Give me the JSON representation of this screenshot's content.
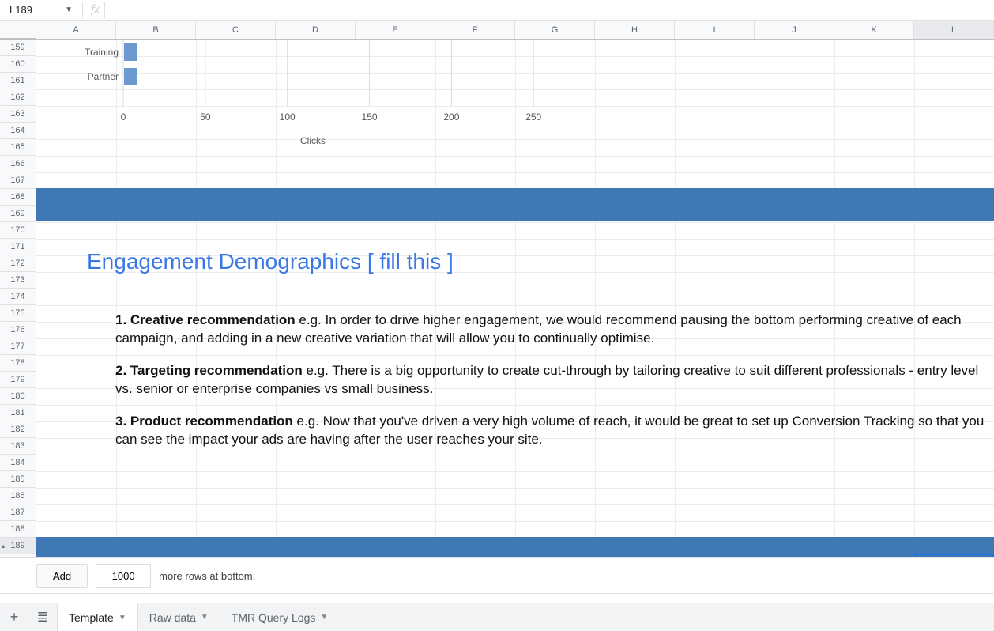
{
  "name_box": {
    "value": "L189"
  },
  "formula": {
    "value": ""
  },
  "columns": [
    "A",
    "B",
    "C",
    "D",
    "E",
    "F",
    "G",
    "H",
    "I",
    "J",
    "K",
    "L"
  ],
  "active_column": "L",
  "rows": [
    "159",
    "160",
    "161",
    "162",
    "163",
    "164",
    "165",
    "166",
    "167",
    "168",
    "169",
    "170",
    "171",
    "172",
    "173",
    "174",
    "175",
    "176",
    "177",
    "178",
    "179",
    "180",
    "181",
    "182",
    "183",
    "184",
    "185",
    "186",
    "187",
    "188",
    "189"
  ],
  "active_row": "189",
  "chart_data": {
    "type": "bar",
    "orientation": "horizontal",
    "categories": [
      "Training",
      "Partner"
    ],
    "values": [
      8,
      8
    ],
    "xlabel": "Clicks",
    "ylabel": "",
    "ticks": [
      0,
      50,
      100,
      150,
      200,
      250
    ],
    "xlim": [
      0,
      260
    ]
  },
  "bands": {
    "color": "#3f78b5"
  },
  "heading": "Engagement Demographics [ fill this ]",
  "recs": {
    "r1_bold": "1. Creative recommendation",
    "r1_rest": " e.g. In order to drive higher engagement, we would recommend pausing the bottom performing creative of each campaign, and adding in a new creative variation that will allow you to continually optimise.",
    "r2_bold": "2. Targeting recommendation",
    "r2_rest": " e.g. There is a big opportunity to create cut-through by tailoring creative to suit different professionals - entry level vs. senior or enterprise companies vs small business.",
    "r3_bold": "3. Product recommendation",
    "r3_rest": " e.g. Now that you've driven a very high volume of reach, it would be great to set up Conversion Tracking so that you can see the impact your ads are having after the user reaches your site."
  },
  "add_rows": {
    "button": "Add",
    "count": "1000",
    "suffix": "more rows at bottom."
  },
  "sheets": {
    "add_icon": "+",
    "list_icon": "≣",
    "tabs": [
      {
        "label": "Template",
        "active": true
      },
      {
        "label": "Raw data",
        "active": false
      },
      {
        "label": "TMR Query Logs",
        "active": false
      }
    ]
  }
}
